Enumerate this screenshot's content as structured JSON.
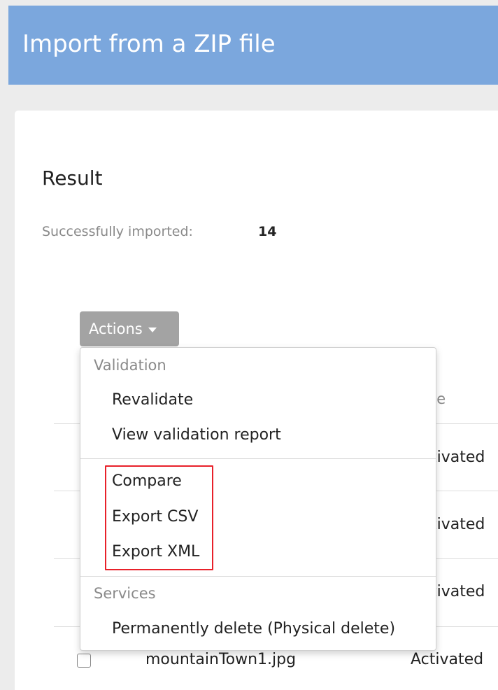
{
  "header": {
    "title": "Import from a ZIP file"
  },
  "result": {
    "title": "Result",
    "imported_label": "Successfully imported:",
    "imported_count": "14"
  },
  "actions": {
    "label": "Actions"
  },
  "table": {
    "state_header_fragment": "te",
    "rows": [
      {
        "status": "tivated"
      },
      {
        "status": "tivated"
      },
      {
        "status": "tivated"
      },
      {
        "file": "mountainTown1.jpg",
        "status": "Activated"
      }
    ]
  },
  "menu": {
    "sections": [
      {
        "label": "Validation",
        "items": [
          "Revalidate",
          "View validation report"
        ]
      },
      {
        "label": "",
        "items": [
          "Compare",
          "Export CSV",
          "Export XML"
        ]
      },
      {
        "label": "Services",
        "items": [
          "Permanently delete (Physical delete)"
        ]
      }
    ],
    "highlight_color": "#e8212a"
  }
}
